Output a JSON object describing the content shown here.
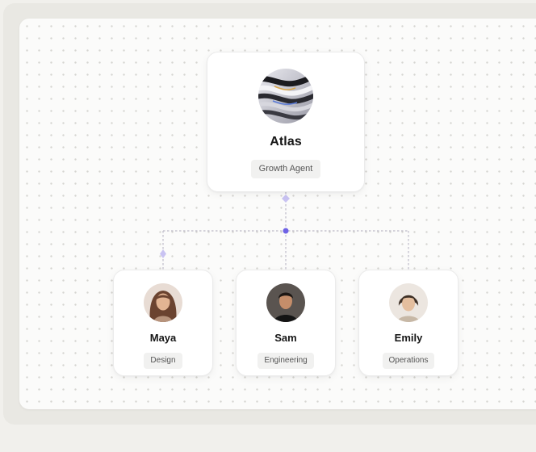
{
  "root": {
    "name": "Atlas",
    "role": "Growth Agent",
    "avatar_icon": "abstract-swirl-avatar"
  },
  "children": [
    {
      "name": "Maya",
      "role": "Design",
      "avatar_icon": "person-long-hair-avatar"
    },
    {
      "name": "Sam",
      "role": "Engineering",
      "avatar_icon": "person-dark-hair-avatar"
    },
    {
      "name": "Emily",
      "role": "Operations",
      "avatar_icon": "person-short-hair-avatar"
    }
  ],
  "colors": {
    "accent": "#6e62e5",
    "accent_light": "#c9c3f2",
    "connector": "#bdbac8",
    "canvas": "#fbfbfa",
    "card": "#ffffff",
    "badge_bg": "#f1f1f0"
  }
}
